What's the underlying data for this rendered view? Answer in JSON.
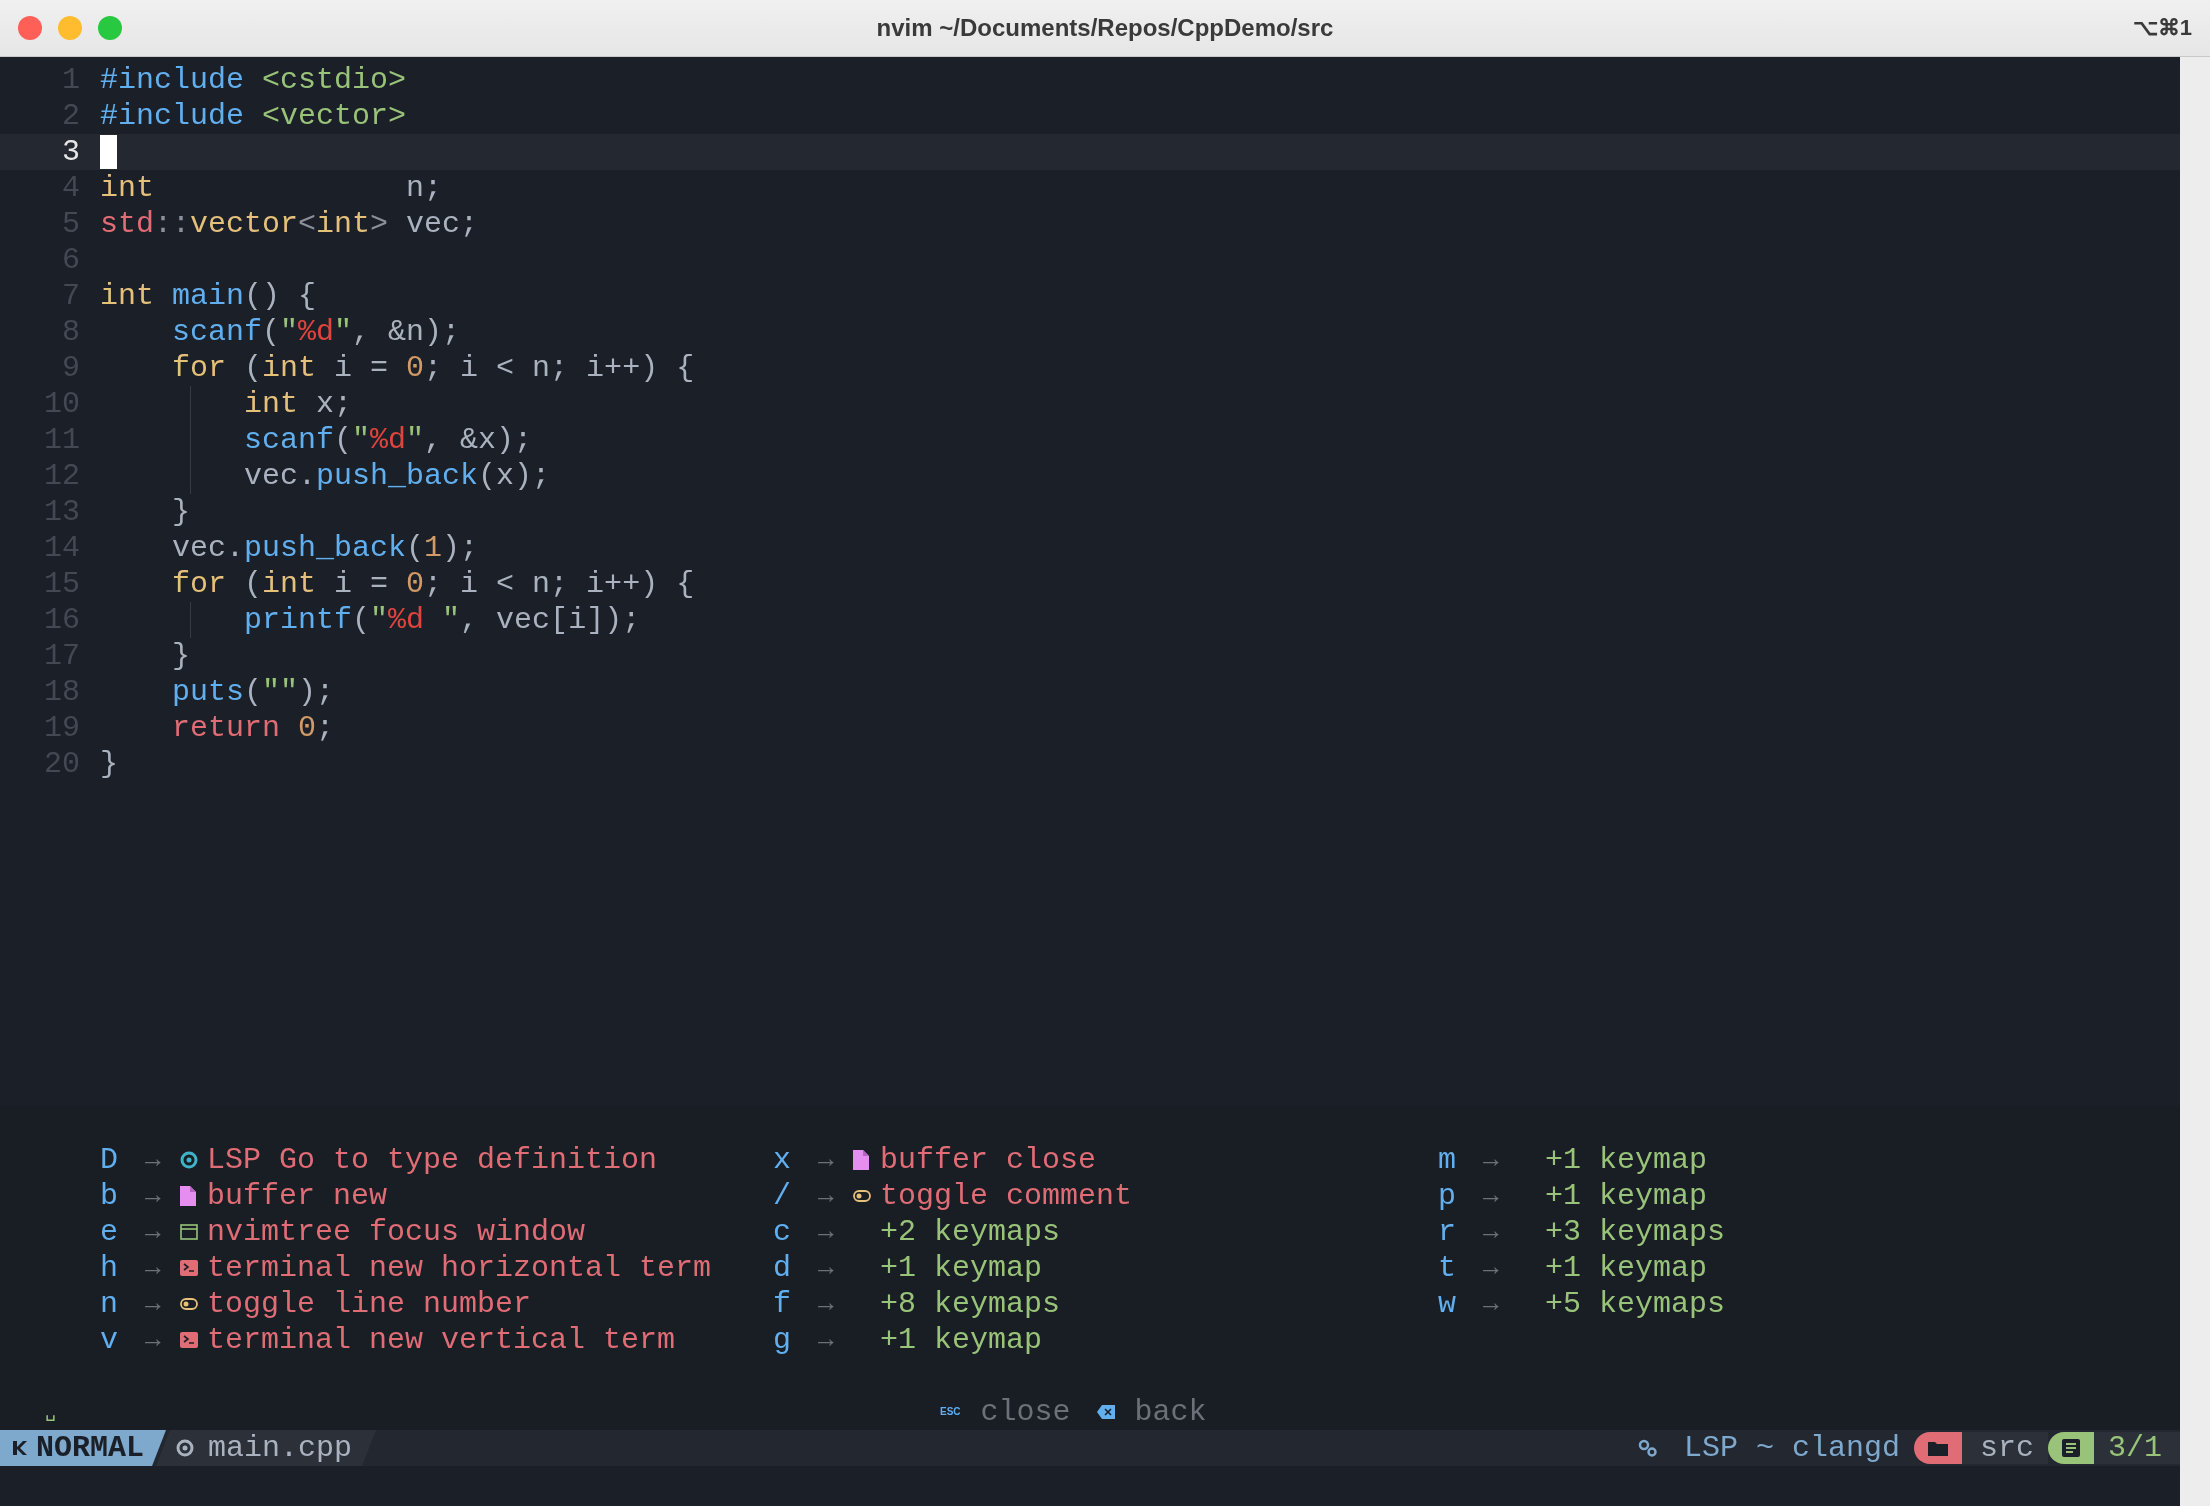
{
  "window": {
    "title": "nvim ~/Documents/Repos/CppDemo/src",
    "shortcut": "⌥⌘1"
  },
  "editor": {
    "lines": [
      {
        "number": "1",
        "current": false,
        "guide": false,
        "tokens": [
          {
            "text": "#include ",
            "kind": "pre"
          },
          {
            "text": "<cstdio>",
            "kind": "header"
          }
        ]
      },
      {
        "number": "2",
        "current": false,
        "guide": false,
        "tokens": [
          {
            "text": "#include ",
            "kind": "pre"
          },
          {
            "text": "<vector>",
            "kind": "header"
          }
        ]
      },
      {
        "number": "3",
        "current": true,
        "guide": false
      },
      {
        "number": "4",
        "current": false,
        "guide": false,
        "tokens": [
          {
            "text": "int",
            "kind": "type"
          },
          {
            "text": "              n;",
            "kind": "text"
          }
        ]
      },
      {
        "number": "5",
        "current": false,
        "guide": false,
        "tokens": [
          {
            "text": "std",
            "kind": "ns"
          },
          {
            "text": "::",
            "kind": "punct"
          },
          {
            "text": "vector",
            "kind": "type"
          },
          {
            "text": "<",
            "kind": "punct"
          },
          {
            "text": "int",
            "kind": "type"
          },
          {
            "text": ">",
            "kind": "punct"
          },
          {
            "text": " vec;",
            "kind": "text"
          }
        ]
      },
      {
        "number": "6",
        "current": false,
        "guide": false
      },
      {
        "number": "7",
        "current": false,
        "guide": false,
        "tokens": [
          {
            "text": "int ",
            "kind": "type"
          },
          {
            "text": "main",
            "kind": "func"
          },
          {
            "text": "() {",
            "kind": "text"
          }
        ]
      },
      {
        "number": "8",
        "current": false,
        "guide": false,
        "tokens": [
          {
            "text": "    scanf",
            "kind": "func"
          },
          {
            "text": "(",
            "kind": "text"
          },
          {
            "text": "\"",
            "kind": "str"
          },
          {
            "text": "%d",
            "kind": "fmt"
          },
          {
            "text": "\"",
            "kind": "str"
          },
          {
            "text": ", &n);",
            "kind": "text"
          }
        ]
      },
      {
        "number": "9",
        "current": false,
        "guide": false,
        "tokens": [
          {
            "text": "    for",
            "kind": "type"
          },
          {
            "text": " (",
            "kind": "text"
          },
          {
            "text": "int",
            "kind": "type"
          },
          {
            "text": " i = ",
            "kind": "text"
          },
          {
            "text": "0",
            "kind": "num"
          },
          {
            "text": "; i < n; i++) {",
            "kind": "text"
          }
        ]
      },
      {
        "number": "10",
        "current": false,
        "guide": true,
        "tokens": [
          {
            "text": "        int",
            "kind": "type"
          },
          {
            "text": " x;",
            "kind": "text"
          }
        ]
      },
      {
        "number": "11",
        "current": false,
        "guide": true,
        "tokens": [
          {
            "text": "        scanf",
            "kind": "func"
          },
          {
            "text": "(",
            "kind": "text"
          },
          {
            "text": "\"",
            "kind": "str"
          },
          {
            "text": "%d",
            "kind": "fmt"
          },
          {
            "text": "\"",
            "kind": "str"
          },
          {
            "text": ", &x);",
            "kind": "text"
          }
        ]
      },
      {
        "number": "12",
        "current": false,
        "guide": true,
        "tokens": [
          {
            "text": "        vec.",
            "kind": "text"
          },
          {
            "text": "push_back",
            "kind": "func"
          },
          {
            "text": "(x);",
            "kind": "text"
          }
        ]
      },
      {
        "number": "13",
        "current": false,
        "guide": false,
        "tokens": [
          {
            "text": "    }",
            "kind": "text"
          }
        ]
      },
      {
        "number": "14",
        "current": false,
        "guide": false,
        "tokens": [
          {
            "text": "    vec.",
            "kind": "text"
          },
          {
            "text": "push_back",
            "kind": "func"
          },
          {
            "text": "(",
            "kind": "text"
          },
          {
            "text": "1",
            "kind": "num"
          },
          {
            "text": ");",
            "kind": "text"
          }
        ]
      },
      {
        "number": "15",
        "current": false,
        "guide": false,
        "tokens": [
          {
            "text": "    for",
            "kind": "type"
          },
          {
            "text": " (",
            "kind": "text"
          },
          {
            "text": "int",
            "kind": "type"
          },
          {
            "text": " i = ",
            "kind": "text"
          },
          {
            "text": "0",
            "kind": "num"
          },
          {
            "text": "; i < n; i++) {",
            "kind": "text"
          }
        ]
      },
      {
        "number": "16",
        "current": false,
        "guide": true,
        "tokens": [
          {
            "text": "        printf",
            "kind": "func"
          },
          {
            "text": "(",
            "kind": "text"
          },
          {
            "text": "\"",
            "kind": "str"
          },
          {
            "text": "%d",
            "kind": "fmt"
          },
          {
            "text": " \"",
            "kind": "str"
          },
          {
            "text": ", vec[i]);",
            "kind": "text"
          }
        ]
      },
      {
        "number": "17",
        "current": false,
        "guide": false,
        "tokens": [
          {
            "text": "    }",
            "kind": "text"
          }
        ]
      },
      {
        "number": "18",
        "current": false,
        "guide": false,
        "tokens": [
          {
            "text": "    puts",
            "kind": "func"
          },
          {
            "text": "(",
            "kind": "text"
          },
          {
            "text": "\"\"",
            "kind": "str"
          },
          {
            "text": ");",
            "kind": "text"
          }
        ]
      },
      {
        "number": "19",
        "current": false,
        "guide": false,
        "tokens": [
          {
            "text": "    return ",
            "kind": "ns"
          },
          {
            "text": "0",
            "kind": "num"
          },
          {
            "text": ";",
            "kind": "text"
          }
        ]
      },
      {
        "number": "20",
        "current": false,
        "guide": false,
        "tokens": [
          {
            "text": "}",
            "kind": "text"
          }
        ]
      }
    ]
  },
  "which_key": {
    "columns": [
      [
        {
          "key": "D",
          "arrow": "→",
          "kind": "lsp",
          "description": "LSP Go to type definition"
        },
        {
          "key": "b",
          "arrow": "→",
          "kind": "buffer",
          "description": "buffer new"
        },
        {
          "key": "e",
          "arrow": "→",
          "kind": "tree",
          "description": "nvimtree focus window"
        },
        {
          "key": "h",
          "arrow": "→",
          "kind": "terminal",
          "description": "terminal new horizontal term"
        },
        {
          "key": "n",
          "arrow": "→",
          "kind": "toggle",
          "description": "toggle line number"
        },
        {
          "key": "v",
          "arrow": "→",
          "kind": "terminal",
          "description": "terminal new vertical term"
        }
      ],
      [
        {
          "key": "x",
          "arrow": "→",
          "kind": "buffer",
          "description": "buffer close"
        },
        {
          "key": "/",
          "arrow": "→",
          "kind": "toggle",
          "description": "toggle comment"
        },
        {
          "key": "c",
          "arrow": "→",
          "kind": "group",
          "description": "+2 keymaps"
        },
        {
          "key": "d",
          "arrow": "→",
          "kind": "group",
          "description": "+1 keymap"
        },
        {
          "key": "f",
          "arrow": "→",
          "kind": "group",
          "description": "+8 keymaps"
        },
        {
          "key": "g",
          "arrow": "→",
          "kind": "group",
          "description": "+1 keymap"
        }
      ],
      [
        {
          "key": "m",
          "arrow": "→",
          "kind": "group",
          "description": "+1 keymap"
        },
        {
          "key": "p",
          "arrow": "→",
          "kind": "group",
          "description": "+1 keymap"
        },
        {
          "key": "r",
          "arrow": "→",
          "kind": "group",
          "description": "+3 keymaps"
        },
        {
          "key": "t",
          "arrow": "→",
          "kind": "group",
          "description": "+1 keymap"
        },
        {
          "key": "w",
          "arrow": "→",
          "kind": "group",
          "description": "+5 keymaps"
        }
      ]
    ],
    "prefix": "␣",
    "hints": [
      {
        "kind": "text",
        "key": "ESC",
        "label": "close"
      },
      {
        "kind": "icon",
        "label": "back"
      }
    ]
  },
  "status_bar": {
    "mode": "NORMAL",
    "file": "main.cpp",
    "lsp": "LSP ~ clangd",
    "cwd": "src",
    "position": "3/1"
  }
}
